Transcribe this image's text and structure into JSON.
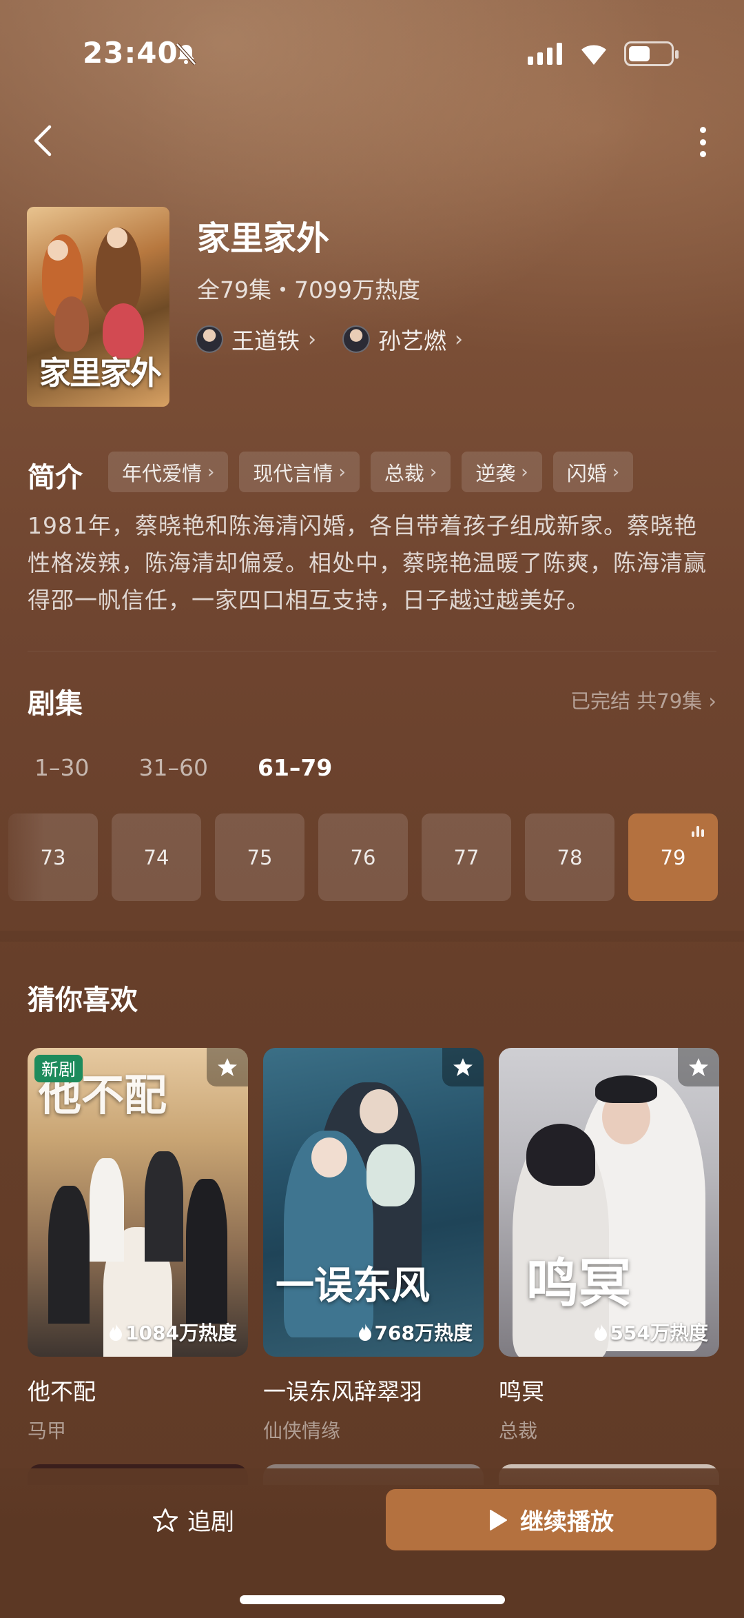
{
  "status_bar": {
    "time": "23:40"
  },
  "show": {
    "title": "家里家外",
    "meta": "全79集・7099万热度",
    "poster_title": "家里家外",
    "actors": [
      {
        "name": "王道铁"
      },
      {
        "name": "孙艺燃"
      }
    ]
  },
  "synopsis": {
    "label": "简介",
    "tags": [
      "年代爱情",
      "现代言情",
      "总裁",
      "逆袭",
      "闪婚"
    ],
    "text": "1981年，蔡晓艳和陈海清闪婚，各自带着孩子组成新家。蔡晓艳性格泼辣，陈海清却偏爱。相处中，蔡晓艳温暖了陈爽，陈海清赢得邵一帆信任，一家四口相互支持，日子越过越美好。"
  },
  "episodes": {
    "title": "剧集",
    "status": "已完结 共79集",
    "ranges": [
      "1–30",
      "31–60",
      "61–79"
    ],
    "active_range": 2,
    "items": [
      "73",
      "74",
      "75",
      "76",
      "77",
      "78",
      "79"
    ],
    "current": "79"
  },
  "recommend": {
    "title": "猜你喜欢",
    "items": [
      {
        "name": "他不配",
        "genre": "马甲",
        "heat": "1084万热度",
        "badge": "新剧",
        "art_text": "他不配"
      },
      {
        "name": "一误东风辞翠羽",
        "genre": "仙侠情缘",
        "heat": "768万热度",
        "art_text": "一误东风"
      },
      {
        "name": "鸣冥",
        "genre": "总裁",
        "heat": "554万热度",
        "art_text": "鸣冥"
      }
    ]
  },
  "bottom": {
    "follow_label": "追剧",
    "play_label": "继续播放"
  },
  "colors": {
    "accent": "#b4713f",
    "badge_green": "#1d8b5c",
    "background": "#5e3a25"
  },
  "icons": [
    "bell-muted-icon",
    "signal-icon",
    "wifi-icon",
    "battery-icon",
    "back-icon",
    "more-icon",
    "chevron-right-icon",
    "star-icon",
    "flame-icon",
    "play-icon",
    "playing-bars-icon"
  ]
}
